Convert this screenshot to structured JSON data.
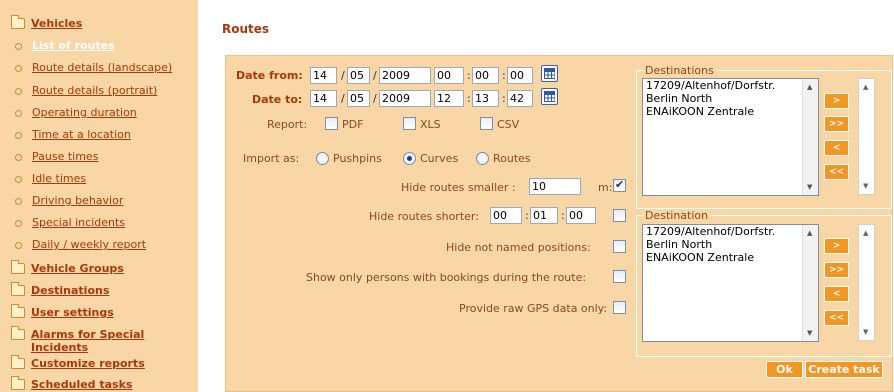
{
  "sidebar": {
    "items": [
      {
        "label": "Vehicles",
        "type": "folder"
      },
      {
        "label": "List of routes",
        "type": "sub",
        "active": true
      },
      {
        "label": "Route details (landscape)",
        "type": "sub"
      },
      {
        "label": "Route details (portrait)",
        "type": "sub"
      },
      {
        "label": "Operating duration",
        "type": "sub"
      },
      {
        "label": "Time at a location",
        "type": "sub"
      },
      {
        "label": "Pause times",
        "type": "sub"
      },
      {
        "label": "Idle times",
        "type": "sub"
      },
      {
        "label": "Driving behavior",
        "type": "sub"
      },
      {
        "label": "Special incidents",
        "type": "sub"
      },
      {
        "label": "Daily / weekly report",
        "type": "sub"
      },
      {
        "label": "Vehicle Groups",
        "type": "folder"
      },
      {
        "label": "Destinations",
        "type": "folder"
      },
      {
        "label": "User settings",
        "type": "folder"
      },
      {
        "label": "Alarms for Special Incidents",
        "type": "folder"
      },
      {
        "label": "Customize reports",
        "type": "folder"
      },
      {
        "label": "Scheduled tasks",
        "type": "folder"
      }
    ]
  },
  "main": {
    "title": "Routes",
    "date_from": {
      "label": "Date from:",
      "day": "14",
      "month": "05",
      "year": "2009",
      "hour": "00",
      "minute": "00",
      "second": "00"
    },
    "date_to": {
      "label": "Date to:",
      "day": "14",
      "month": "05",
      "year": "2009",
      "hour": "12",
      "minute": "13",
      "second": "42"
    },
    "separators": {
      "slash": "/",
      "colon": ":"
    },
    "report": {
      "label": "Report:",
      "pdf": "PDF",
      "xls": "XLS",
      "csv": "CSV"
    },
    "import_as": {
      "label": "Import as:",
      "options": [
        "Pushpins",
        "Curves",
        "Routes"
      ],
      "selected": "Curves"
    },
    "hide_smaller": {
      "label": "Hide routes smaller :",
      "value": "10",
      "unit": "m:",
      "checked": true
    },
    "hide_shorter": {
      "label": "Hide routes shorter:",
      "hour": "00",
      "minute": "01",
      "second": "00",
      "checked": false
    },
    "hide_not_named": {
      "label": "Hide not named positions:",
      "checked": false
    },
    "show_persons": {
      "label": "Show only persons with bookings during the route:",
      "checked": false
    },
    "raw_gps": {
      "label": "Provide raw GPS data only:",
      "checked": false
    },
    "destinations_top": {
      "legend": "Destinations",
      "items": [
        "17209/Altenhof/Dorfstr.",
        "Berlin North",
        "ENAiKOON Zentrale"
      ]
    },
    "destinations_bottom": {
      "legend": "Destination",
      "items": [
        "17209/Altenhof/Dorfstr.",
        "Berlin North",
        "ENAiKOON Zentrale"
      ]
    },
    "move_buttons": {
      "add": ">",
      "add_all": ">>",
      "remove": "<",
      "remove_all": "<<"
    },
    "ok_label": "Ok",
    "create_task_label": "Create task"
  },
  "colors": {
    "panel_bg": "#f9d6a6",
    "link": "#a8390a",
    "accent_button": "#f29624"
  }
}
